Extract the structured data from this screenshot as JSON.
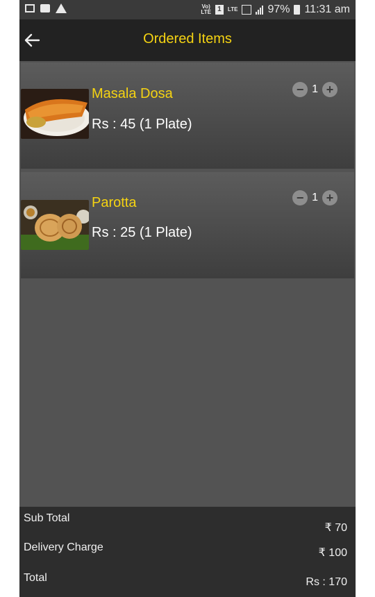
{
  "status_bar": {
    "network_label": "LTE",
    "sim_label": "1",
    "battery": "97%",
    "time": "11:31 am",
    "icons": [
      "image-icon",
      "message-icon",
      "warning-icon",
      "volte-icon",
      "sim-icon",
      "signal-icon",
      "battery-icon"
    ]
  },
  "app_bar": {
    "title": "Ordered Items",
    "back_icon": "arrow-left-icon",
    "title_color": "#f5d312"
  },
  "items": [
    {
      "name": "Masala Dosa",
      "price": "Rs : 45 (1 Plate)",
      "quantity": "1",
      "minus": "−",
      "plus": "+"
    },
    {
      "name": "Parotta",
      "price": "Rs : 25 (1 Plate)",
      "quantity": "1",
      "minus": "−",
      "plus": "+"
    }
  ],
  "summary": {
    "sub_total_label": "Sub Total",
    "sub_total_value": "₹ 70",
    "delivery_label": "Delivery Charge",
    "delivery_value": "₹ 100",
    "total_label": "Total",
    "total_value": "Rs : 170"
  }
}
